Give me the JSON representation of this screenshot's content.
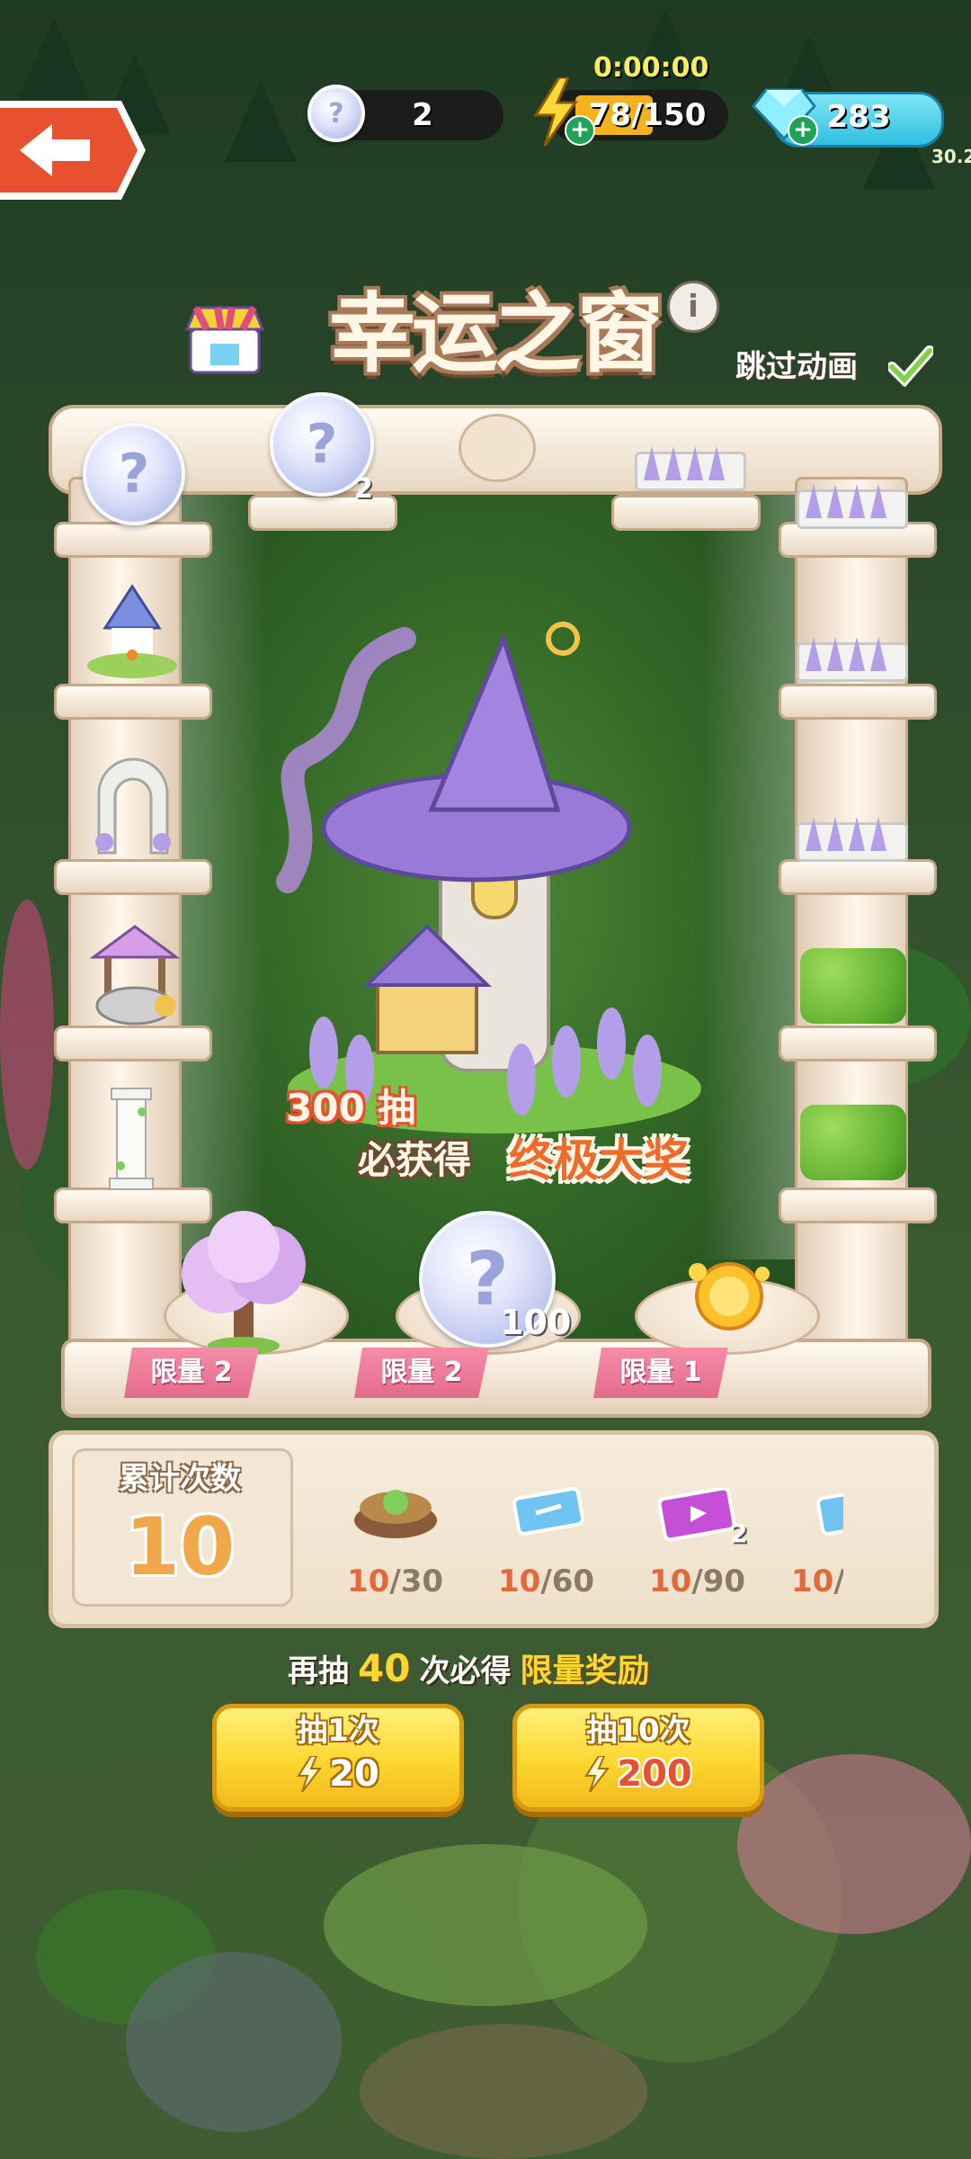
{
  "hud": {
    "timer": "0:00:00",
    "tickets": "2",
    "energy": "78/150",
    "gems": "283",
    "bg_level": "30.2"
  },
  "title": {
    "text": "幸运之窗",
    "skip_label": "跳过动画",
    "skip_checked": true
  },
  "prize": {
    "draws_text": "300 抽",
    "guarantee_prefix": "必获得",
    "grand_prize": "终极大奖"
  },
  "top_shelf": {
    "left_coin_count": "2"
  },
  "pedestals": [
    {
      "limit_label": "限量 2",
      "item": "cherry-tree-icon"
    },
    {
      "limit_label": "限量 2",
      "item": "ticket-coin-icon",
      "count": "100"
    },
    {
      "limit_label": "限量 1",
      "item": "golden-sun-icon"
    }
  ],
  "counter": {
    "label": "累计次数",
    "value": "10",
    "milestones": [
      {
        "icon": "stump-icon",
        "current": "10",
        "target": "/30"
      },
      {
        "icon": "ticket-icon",
        "current": "10",
        "target": "/60"
      },
      {
        "icon": "video-card-icon",
        "badge": "2",
        "current": "10",
        "target": "/90"
      },
      {
        "icon": "ticket-icon",
        "current": "10",
        "target": "/"
      }
    ]
  },
  "hint": {
    "prefix": "再抽",
    "count": "40",
    "middle": "次必得",
    "reward": "限量奖励"
  },
  "buttons": {
    "single": {
      "label": "抽1次",
      "cost": "20"
    },
    "ten": {
      "label": "抽10次",
      "cost": "200"
    }
  },
  "colors": {
    "accent_orange": "#e8512f",
    "button_yellow": "#fbd72f",
    "limit_pink": "#e56a8a",
    "progress_current": "#e26a3a"
  }
}
